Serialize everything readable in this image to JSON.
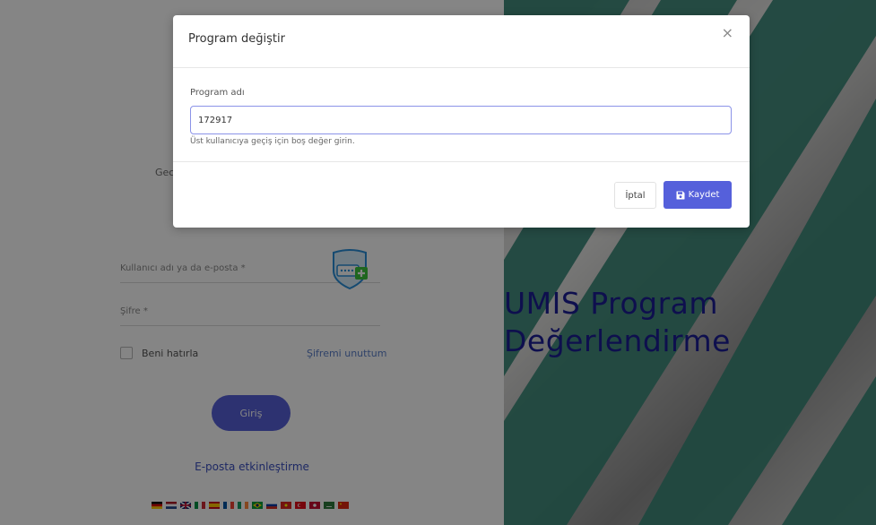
{
  "login": {
    "subtitle": "Gec",
    "username_label": "Kullanıcı adı ya da e-posta *",
    "password_label": "Şifre *",
    "remember_label": "Beni hatırla",
    "forgot_label": "Şifremi unuttum",
    "login_button": "Giriş",
    "activate_link": "E-posta etkinleştirme"
  },
  "hero": {
    "line1": "UMIS Program",
    "line2": "Değerlendirme"
  },
  "modal": {
    "title": "Program değiştir",
    "close_label": "×",
    "field_label": "Program adı",
    "field_value": "172917",
    "hint": "Üst kullanıcıya geçiş için boş değer girin.",
    "cancel_label": "İptal",
    "save_label": "Kaydet"
  },
  "colors": {
    "accent": "#5560db",
    "hero_text": "#1b1d96",
    "stripe": "#3d8a7a"
  },
  "icons": {
    "save": "save-icon",
    "close": "close-icon",
    "password_manager": "password-manager-icon"
  }
}
